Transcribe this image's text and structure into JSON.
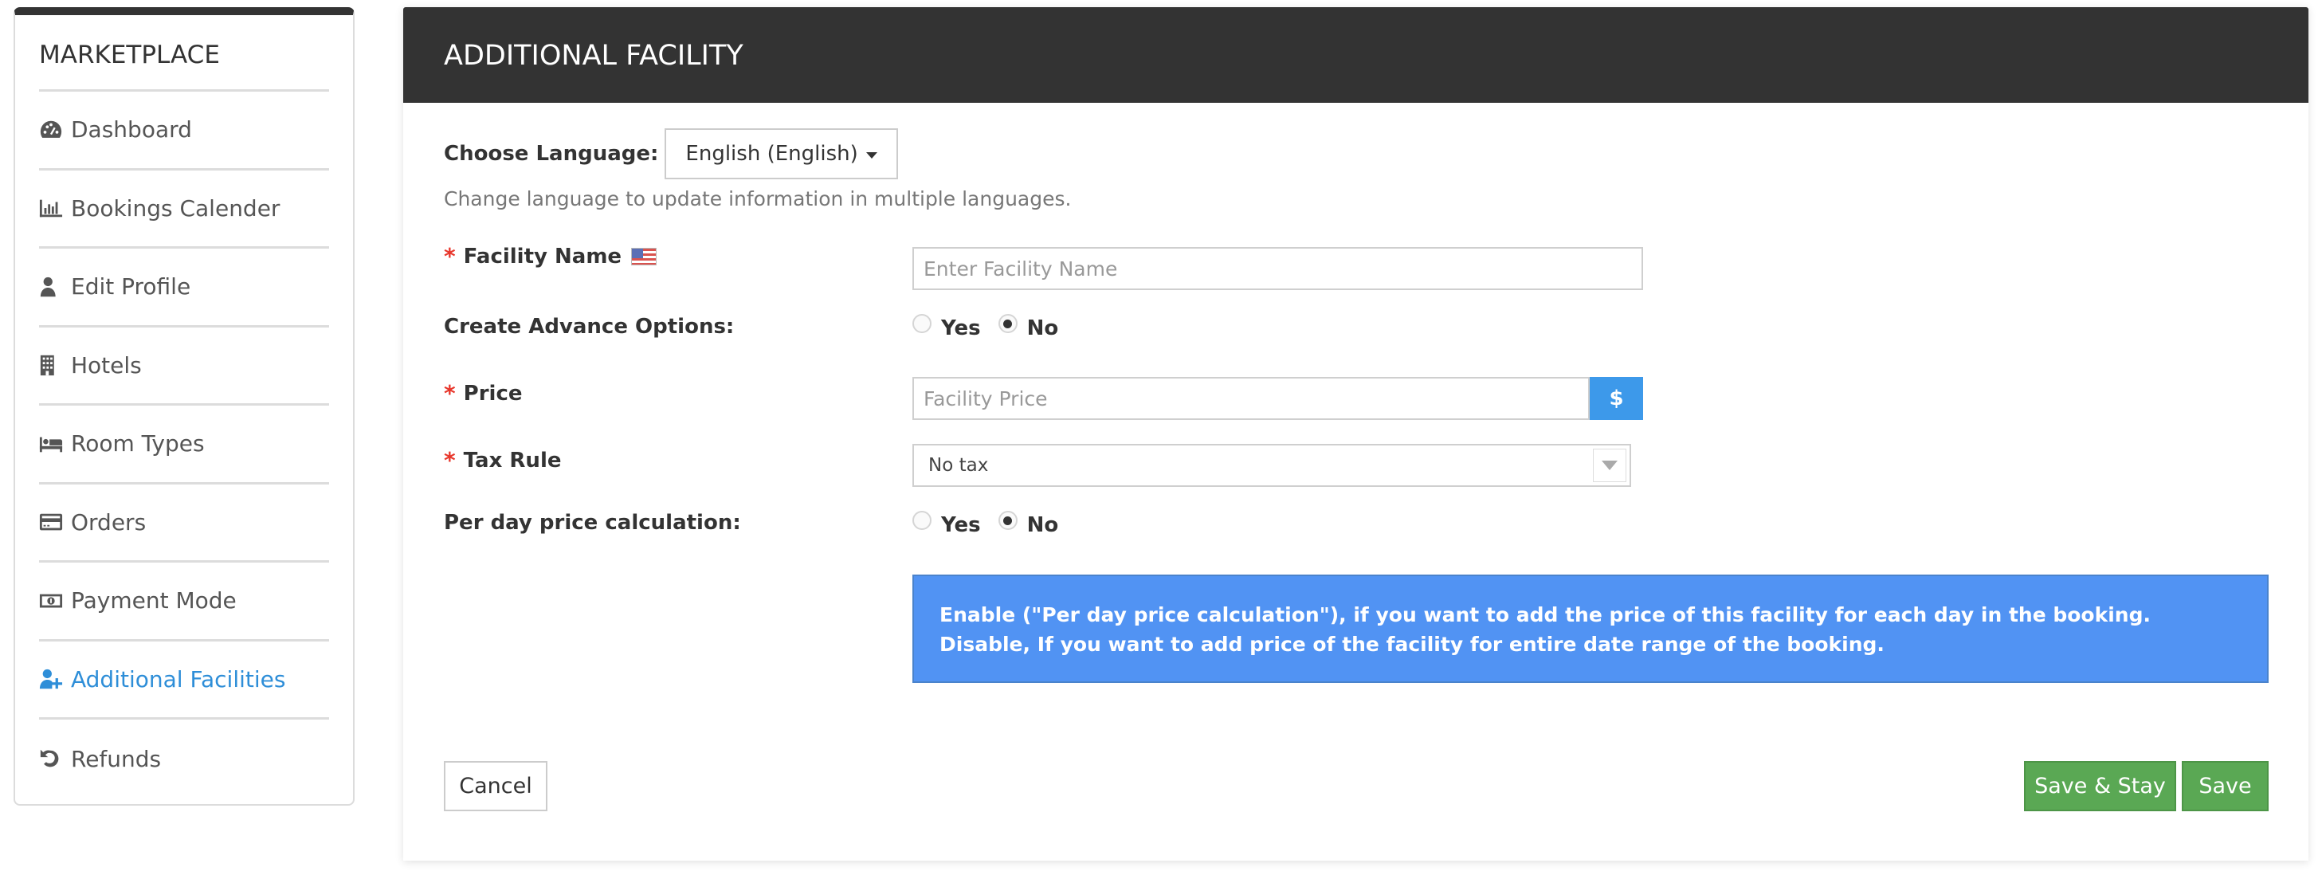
{
  "sidebar": {
    "title": "MARKETPLACE",
    "items": [
      {
        "label": "Dashboard",
        "icon": "dashboard-icon",
        "active": false
      },
      {
        "label": "Bookings Calender",
        "icon": "bar-chart-icon",
        "active": false
      },
      {
        "label": "Edit Profile",
        "icon": "user-icon",
        "active": false
      },
      {
        "label": "Hotels",
        "icon": "building-icon",
        "active": false
      },
      {
        "label": "Room Types",
        "icon": "bed-icon",
        "active": false
      },
      {
        "label": "Orders",
        "icon": "credit-card-icon",
        "active": false
      },
      {
        "label": "Payment Mode",
        "icon": "money-icon",
        "active": false
      },
      {
        "label": "Additional Facilities",
        "icon": "user-plus-icon",
        "active": true
      },
      {
        "label": "Refunds",
        "icon": "undo-icon",
        "active": false
      }
    ]
  },
  "header": {
    "title": "ADDITIONAL FACILITY"
  },
  "language": {
    "label": "Choose Language:",
    "selected": "English (English)",
    "help": "Change language to update information in multiple languages."
  },
  "form": {
    "facility_name": {
      "label": "Facility Name",
      "required": true,
      "placeholder": "Enter Facility Name",
      "value": ""
    },
    "advance_options": {
      "label": "Create Advance Options:",
      "options": [
        "Yes",
        "No"
      ],
      "selected": "No"
    },
    "price": {
      "label": "Price",
      "required": true,
      "placeholder": "Facility Price",
      "value": "",
      "currency_symbol": "$"
    },
    "tax_rule": {
      "label": "Tax Rule",
      "required": true,
      "selected": "No tax"
    },
    "per_day_price": {
      "label": "Per day price calculation:",
      "options": [
        "Yes",
        "No"
      ],
      "selected": "No"
    },
    "info": "Enable (\"Per day price calculation\"), if you want to add the price of this facility for each day in the booking. Disable, If you want to add price of the facility for entire date range of the booking.",
    "required_marker": "*"
  },
  "actions": {
    "cancel": "Cancel",
    "save_stay": "Save & Stay",
    "save": "Save"
  },
  "colors": {
    "accent": "#2e8ed8",
    "header_bg": "#333333",
    "info_bg": "#5193f3",
    "success": "#5aa854",
    "required": "#e8372c",
    "addon": "#3d99ea"
  }
}
